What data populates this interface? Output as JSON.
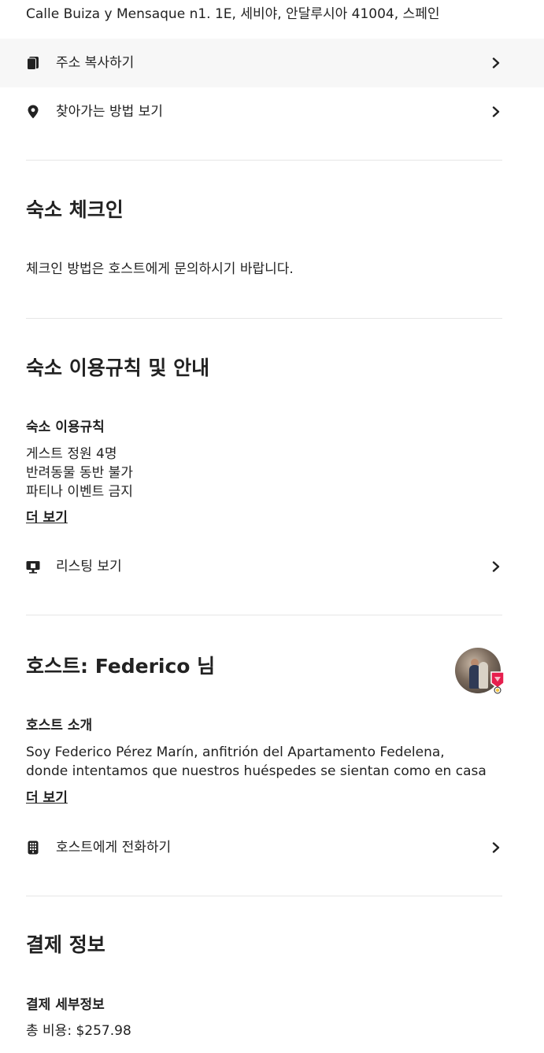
{
  "address": "Calle Buiza y Mensaque n1. 1E, 세비야, 안달루시아 41004, 스페인",
  "actions": {
    "copy_address": "주소 복사하기",
    "directions": "찾아가는 방법 보기",
    "view_listing": "리스팅 보기",
    "call_host": "호스트에게 전화하기"
  },
  "checkin": {
    "title": "숙소 체크인",
    "text": "체크인 방법은 호스트에게 문의하시기 바랍니다."
  },
  "rules": {
    "title": "숙소 이용규칙 및 안내",
    "subtitle": "숙소 이용규칙",
    "items": [
      "게스트 정원 4명",
      "반려동물 동반 불가",
      "파티나 이벤트 금지"
    ],
    "more": "더 보기"
  },
  "host": {
    "title": "호스트: Federico 님",
    "about_title": "호스트 소개",
    "about_lines": [
      "Soy Federico Pérez Marín, anfitrión del Apartamento Fedelena,",
      "donde intentamos que nuestros huéspedes se sientan como en casa"
    ],
    "more": "더 보기"
  },
  "payment": {
    "title": "결제 정보",
    "subtitle": "결제 세부정보",
    "total": "총 비용: $257.98"
  },
  "icons": {
    "copy": "copy-icon",
    "pin": "map-pin-icon",
    "listing": "listing-icon",
    "phone": "phone-icon",
    "chevron": "chevron-right-icon",
    "superhost": "superhost-badge-icon"
  },
  "colors": {
    "text": "#222222",
    "divider": "#e6e6e6",
    "highlight": "#f7f7f7",
    "badge": "#e61e4d"
  }
}
